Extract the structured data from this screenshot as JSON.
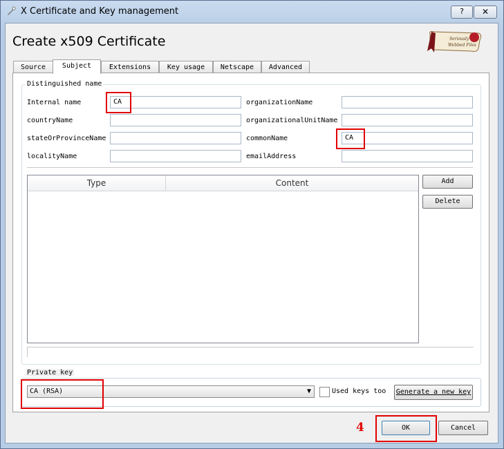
{
  "window": {
    "title": "X Certificate and Key management",
    "help_label": "?",
    "close_label": "✕"
  },
  "heading": "Create x509 Certificate",
  "tabs": [
    {
      "label": "Source"
    },
    {
      "label": "Subject"
    },
    {
      "label": "Extensions"
    },
    {
      "label": "Key usage"
    },
    {
      "label": "Netscape"
    },
    {
      "label": "Advanced"
    }
  ],
  "distinguished": {
    "title": "Distinguished name",
    "internal_name_label": "Internal name",
    "internal_name_value": "CA",
    "country_label": "countryName",
    "country_value": "",
    "state_label": "stateOrProvinceName",
    "state_value": "",
    "locality_label": "localityName",
    "locality_value": "",
    "org_label": "organizationName",
    "org_value": "",
    "orgunit_label": "organizationalUnitName",
    "orgunit_value": "",
    "common_label": "commonName",
    "common_value": "CA",
    "email_label": "emailAddress",
    "email_value": ""
  },
  "table": {
    "columns": [
      "Type",
      "Content"
    ],
    "rows": []
  },
  "buttons": {
    "add": "Add",
    "delete": "Delete",
    "generate": "Generate a new key",
    "ok": "OK",
    "cancel": "Cancel"
  },
  "private_key": {
    "title": "Private key",
    "selected": "CA (RSA)",
    "used_keys_label": "Used keys too",
    "used_keys_checked": false
  },
  "annotation": {
    "step": "4",
    "color": "#e00000"
  }
}
